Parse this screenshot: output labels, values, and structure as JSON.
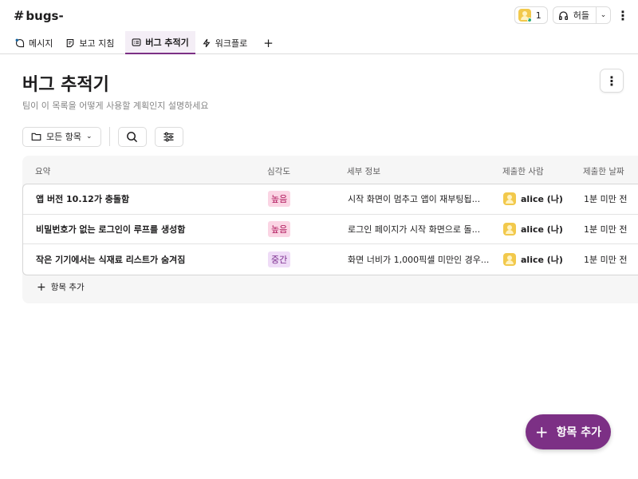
{
  "channel": {
    "hash": "#",
    "name": "bugs-"
  },
  "header": {
    "member_count": "1",
    "huddle_label": "허들"
  },
  "tabs": [
    {
      "label": "메시지",
      "icon": "message-icon",
      "active": false
    },
    {
      "label": "보고 지침",
      "icon": "canvas-icon",
      "active": false
    },
    {
      "label": "버그 추적기",
      "icon": "list-icon",
      "active": true
    },
    {
      "label": "워크플로",
      "icon": "lightning-icon",
      "active": false
    }
  ],
  "page": {
    "title": "버그 추적기",
    "description": "팀이 이 목록을 어떻게 사용할 계획인지 설명하세요"
  },
  "toolbar": {
    "filter_label": "모든 항목"
  },
  "table": {
    "columns": [
      "요약",
      "심각도",
      "세부 정보",
      "제출한 사람",
      "제출한 날짜"
    ],
    "rows": [
      {
        "summary": "앱 버전 10.12가 충돌함",
        "severity": "높음",
        "severity_color": "#fbd5e4",
        "severity_text_color": "#b0195d",
        "details": "시작 화면이 멈추고 앱이 재부팅됩...",
        "submitter": "alice (나)",
        "date": "1분 미만 전"
      },
      {
        "summary": "비밀번호가 없는 로그인이 루프를 생성함",
        "severity": "높음",
        "severity_color": "#fbd5e4",
        "severity_text_color": "#b0195d",
        "details": "로그인 페이지가 시작 화면으로 돌...",
        "submitter": "alice (나)",
        "date": "1분 미만 전"
      },
      {
        "summary": "작은 기기에서는 식재료 리스트가 숨겨짐",
        "severity": "중간",
        "severity_color": "#efdcf7",
        "severity_text_color": "#7a2a8c",
        "details": "화면 너비가 1,000픽셀 미만인 경우...",
        "submitter": "alice (나)",
        "date": "1분 미만 전"
      }
    ],
    "add_label": "항목 추가"
  },
  "fab": {
    "label": "항목 추가"
  },
  "colors": {
    "accent": "#7c3085",
    "border": "#dcdcdc"
  }
}
